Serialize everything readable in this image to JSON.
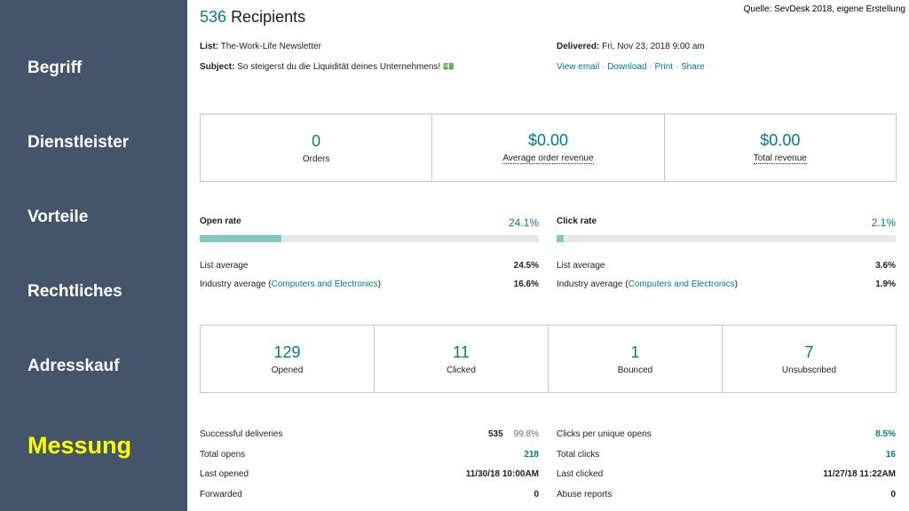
{
  "sidebar": {
    "items": [
      {
        "label": "Begriff"
      },
      {
        "label": "Dienstleister"
      },
      {
        "label": "Vorteile"
      },
      {
        "label": "Rechtliches"
      },
      {
        "label": "Adresskauf"
      },
      {
        "label": "Messung",
        "active": true
      }
    ]
  },
  "source_note": "Quelle: SevDesk 2018, eigene Erstellung",
  "header": {
    "count": "536",
    "title_word": "Recipients",
    "list_label": "List:",
    "list_value": "The-Work-Life Newsletter",
    "subject_label": "Subject:",
    "subject_value": "So steigerst du die Liquidität deines Unternehmens! 💵",
    "delivered_label": "Delivered:",
    "delivered_value": "Fri, Nov 23, 2018 9:00 am",
    "links": [
      "View email",
      "Download",
      "Print",
      "Share"
    ]
  },
  "revenue": [
    {
      "value": "0",
      "label": "Orders"
    },
    {
      "value": "$0.00",
      "label": "Average order revenue"
    },
    {
      "value": "$0.00",
      "label": "Total revenue"
    }
  ],
  "rates": {
    "open": {
      "label": "Open rate",
      "pct": "24.1%",
      "fill": 0.241,
      "list_avg_label": "List average",
      "list_avg": "24.5%",
      "industry_prefix": "Industry average (",
      "industry_link": "Computers and Electronics",
      "industry_suffix": ")",
      "industry_avg": "16.6%"
    },
    "click": {
      "label": "Click rate",
      "pct": "2.1%",
      "fill": 0.021,
      "list_avg_label": "List average",
      "list_avg": "3.6%",
      "industry_prefix": "Industry average (",
      "industry_link": "Computers and Electronics",
      "industry_suffix": ")",
      "industry_avg": "1.9%"
    }
  },
  "engagement": [
    {
      "value": "129",
      "label": "Opened"
    },
    {
      "value": "11",
      "label": "Clicked"
    },
    {
      "value": "1",
      "label": "Bounced"
    },
    {
      "value": "7",
      "label": "Unsubscribed"
    }
  ],
  "details_left": [
    {
      "label": "Successful deliveries",
      "value": "535",
      "extra": "99.8%"
    },
    {
      "label": "Total opens",
      "value": "218"
    },
    {
      "label": "Last opened",
      "value": "11/30/18 10:00AM"
    },
    {
      "label": "Forwarded",
      "value": "0"
    }
  ],
  "details_right": [
    {
      "label": "Clicks per unique opens",
      "value": "8.5%"
    },
    {
      "label": "Total clicks",
      "value": "16"
    },
    {
      "label": "Last clicked",
      "value": "11/27/18 11:22AM"
    },
    {
      "label": "Abuse reports",
      "value": "0"
    }
  ],
  "colors": {
    "accent": "#007c89",
    "sidebar": "#44546a",
    "active_item": "#ffff00",
    "bar_fill": "#7fc9c0"
  }
}
